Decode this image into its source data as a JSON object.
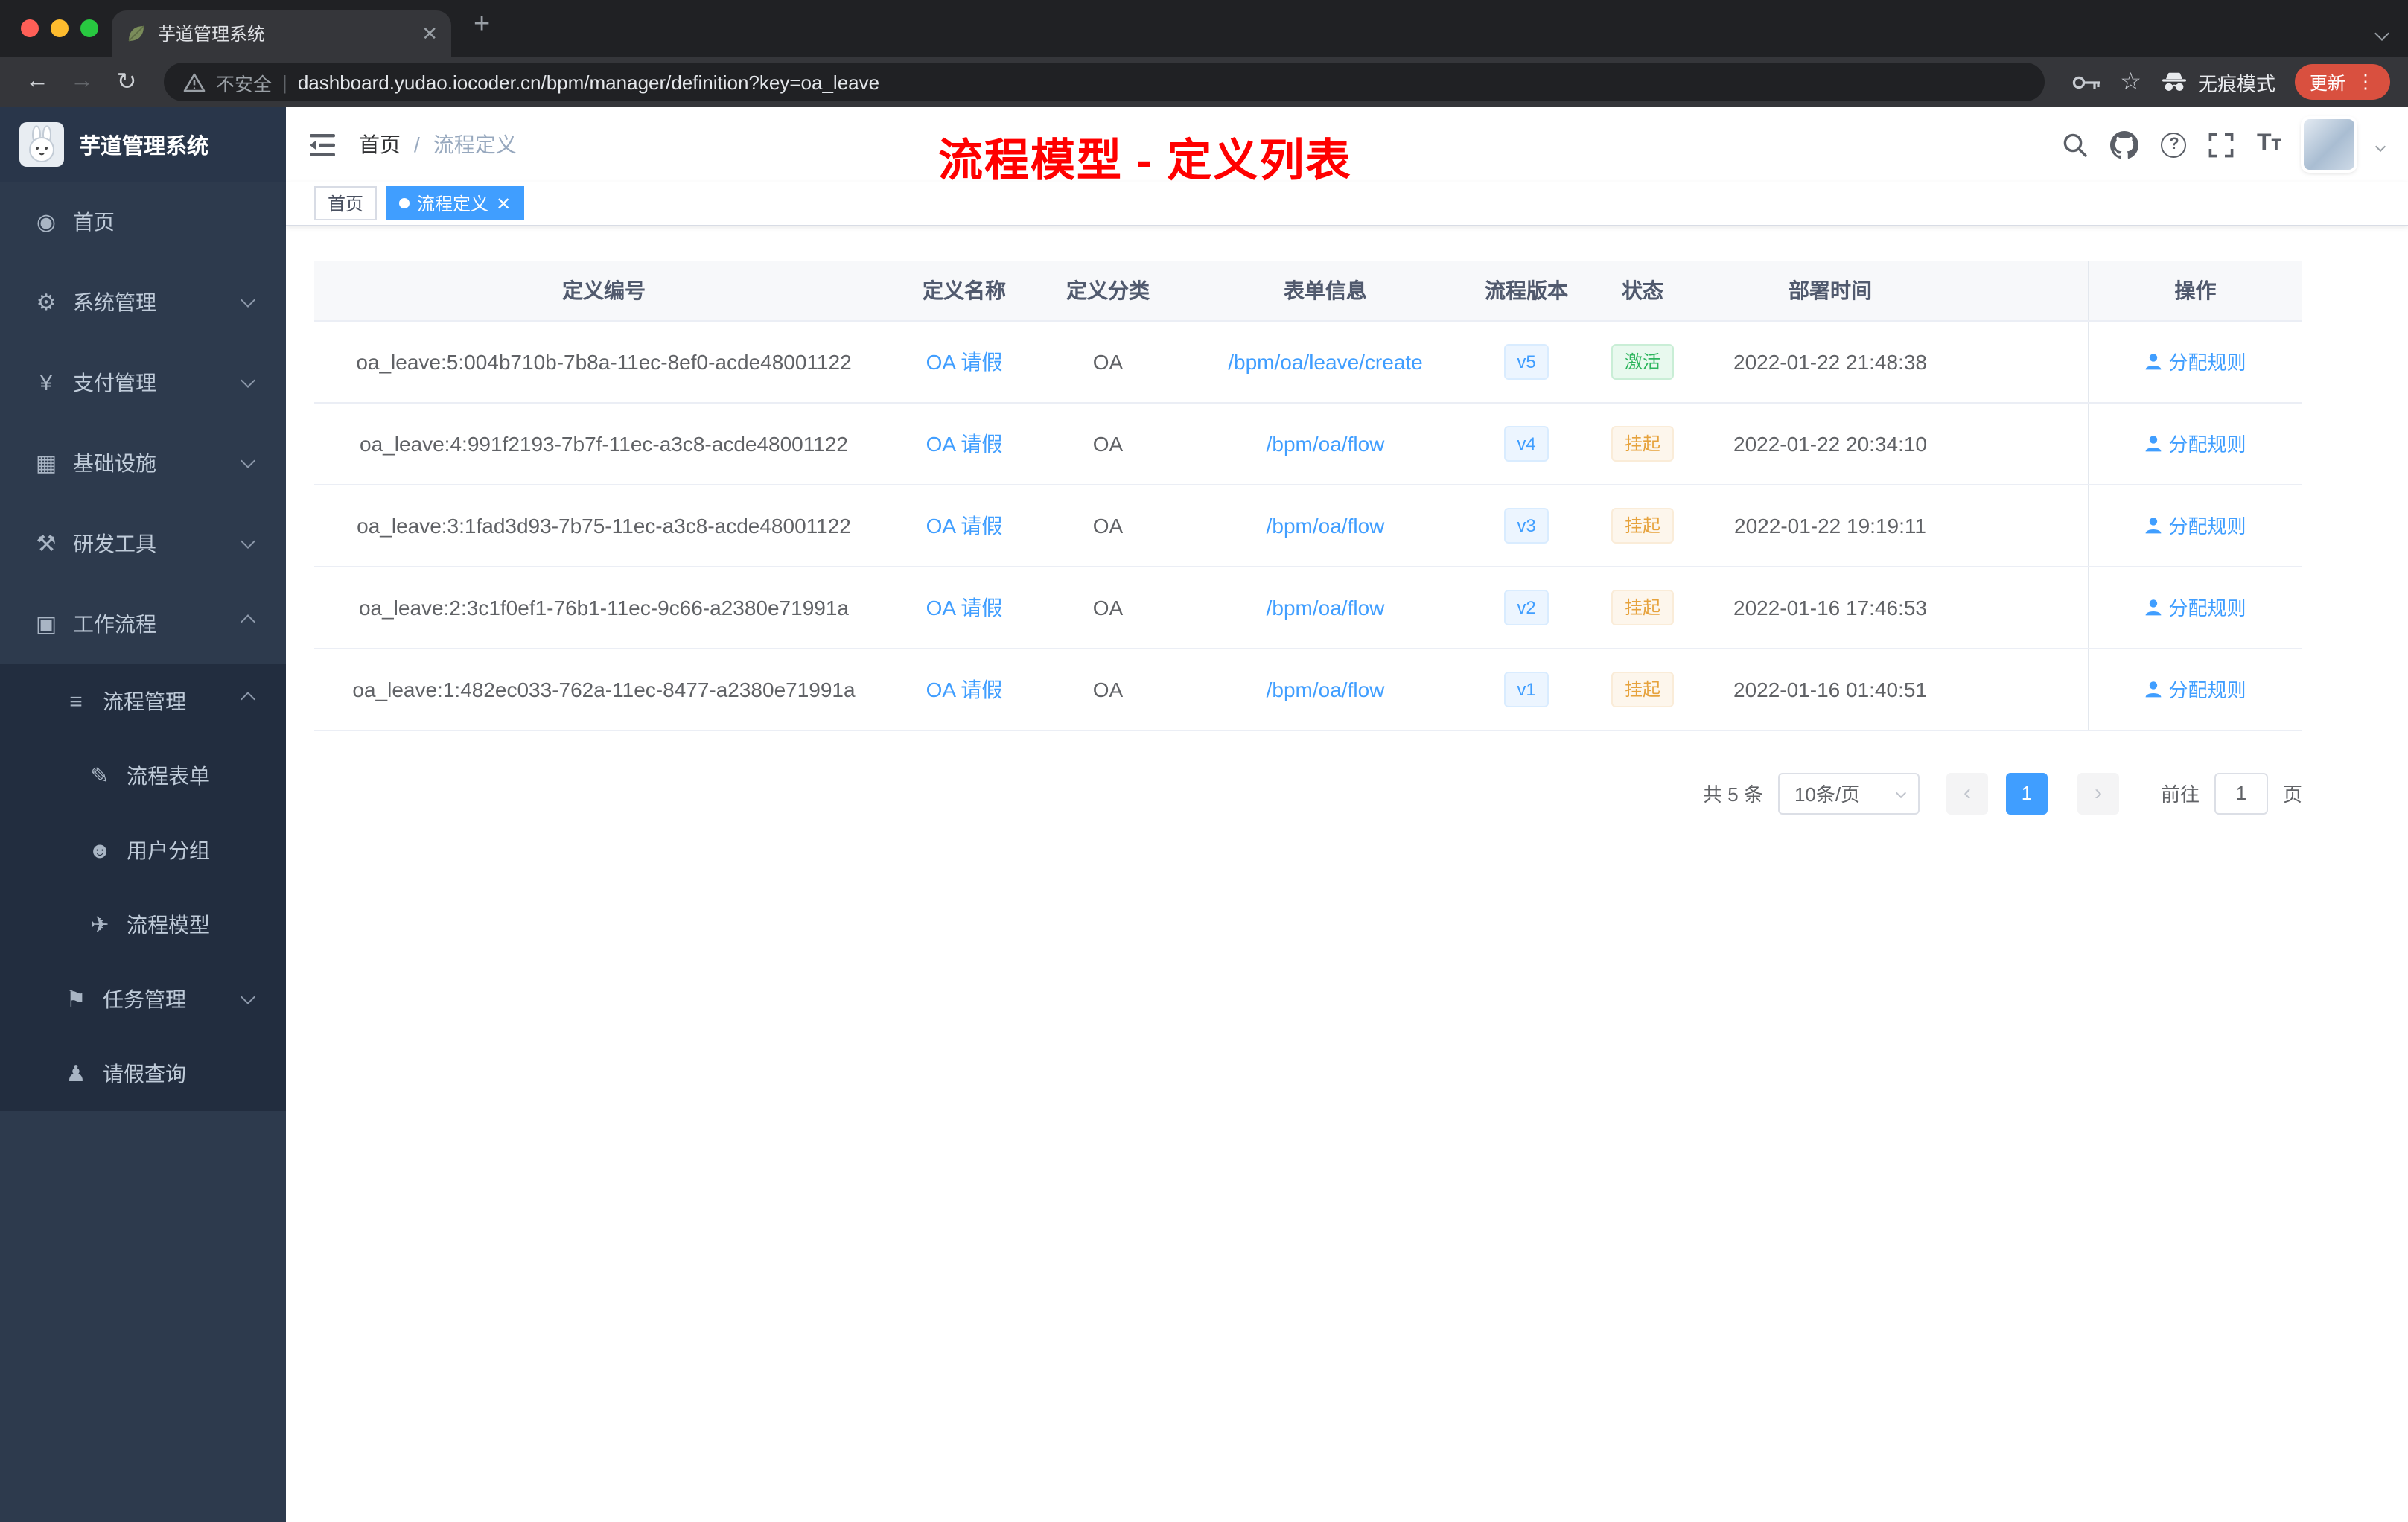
{
  "colors": {
    "accent": "#409eff",
    "success_text": "#2db55d",
    "warning_text": "#e6a23c",
    "annotation_red": "#ff0000",
    "sidebar_bg": "#2d3a4d",
    "submenu_bg": "#222d3f"
  },
  "browser": {
    "tab_title": "芋道管理系统",
    "security_label": "不安全",
    "url": "dashboard.yudao.iocoder.cn/bpm/manager/definition?key=oa_leave",
    "incognito_label": "无痕模式",
    "update_label": "更新"
  },
  "app": {
    "logo_title": "芋道管理系统",
    "breadcrumb": {
      "home": "首页",
      "separator": "/",
      "current": "流程定义"
    },
    "annotation": "流程模型 - 定义列表",
    "tags": {
      "home": "首页",
      "active": "流程定义"
    }
  },
  "sidebar": {
    "items": [
      {
        "label": "首页",
        "icon": "dashboard-icon"
      },
      {
        "label": "系统管理",
        "icon": "gear-icon"
      },
      {
        "label": "支付管理",
        "icon": "yen-icon"
      },
      {
        "label": "基础设施",
        "icon": "monitor-icon"
      },
      {
        "label": "研发工具",
        "icon": "tools-icon"
      },
      {
        "label": "工作流程",
        "icon": "workflow-icon"
      },
      {
        "label": "流程管理",
        "icon": "list-icon"
      },
      {
        "label": "流程表单",
        "icon": "form-icon"
      },
      {
        "label": "用户分组",
        "icon": "users-icon"
      },
      {
        "label": "流程模型",
        "icon": "paper-plane-icon"
      },
      {
        "label": "任务管理",
        "icon": "flag-icon"
      },
      {
        "label": "请假查询",
        "icon": "user-icon"
      }
    ]
  },
  "table": {
    "headers": {
      "id": "定义编号",
      "name": "定义名称",
      "category": "定义分类",
      "form": "表单信息",
      "version": "流程版本",
      "status": "状态",
      "time": "部署时间",
      "action": "操作"
    },
    "rows": [
      {
        "id": "oa_leave:5:004b710b-7b8a-11ec-8ef0-acde48001122",
        "name": "OA 请假",
        "category": "OA",
        "form": "/bpm/oa/leave/create",
        "version": "v5",
        "status": "激活",
        "status_type": "success",
        "time": "2022-01-22 21:48:38",
        "action": "分配规则"
      },
      {
        "id": "oa_leave:4:991f2193-7b7f-11ec-a3c8-acde48001122",
        "name": "OA 请假",
        "category": "OA",
        "form": "/bpm/oa/flow",
        "version": "v4",
        "status": "挂起",
        "status_type": "warning",
        "time": "2022-01-22 20:34:10",
        "action": "分配规则"
      },
      {
        "id": "oa_leave:3:1fad3d93-7b75-11ec-a3c8-acde48001122",
        "name": "OA 请假",
        "category": "OA",
        "form": "/bpm/oa/flow",
        "version": "v3",
        "status": "挂起",
        "status_type": "warning",
        "time": "2022-01-22 19:19:11",
        "action": "分配规则"
      },
      {
        "id": "oa_leave:2:3c1f0ef1-76b1-11ec-9c66-a2380e71991a",
        "name": "OA 请假",
        "category": "OA",
        "form": "/bpm/oa/flow",
        "version": "v2",
        "status": "挂起",
        "status_type": "warning",
        "time": "2022-01-16 17:46:53",
        "action": "分配规则"
      },
      {
        "id": "oa_leave:1:482ec033-762a-11ec-8477-a2380e71991a",
        "name": "OA 请假",
        "category": "OA",
        "form": "/bpm/oa/flow",
        "version": "v1",
        "status": "挂起",
        "status_type": "warning",
        "time": "2022-01-16 01:40:51",
        "action": "分配规则"
      }
    ]
  },
  "pagination": {
    "total": "共 5 条",
    "page_size": "10条/页",
    "page": "1",
    "goto": "前往",
    "goto_value": "1",
    "unit": "页"
  }
}
